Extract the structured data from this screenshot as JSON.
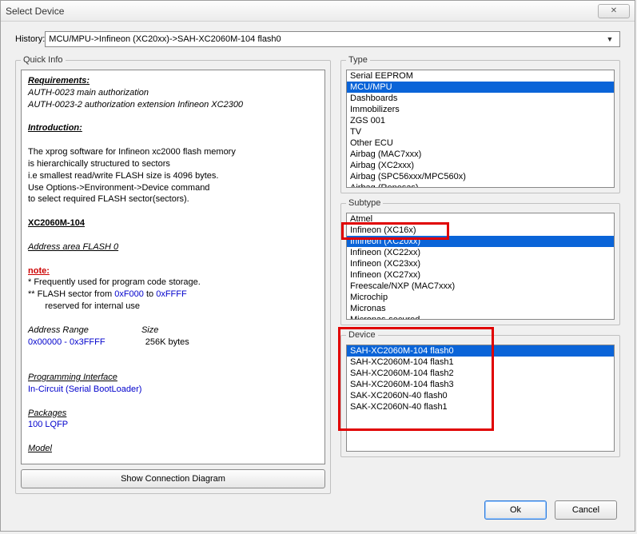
{
  "window": {
    "title": "Select Device"
  },
  "history": {
    "label": "History:",
    "value": "MCU/MPU->Infineon (XC20xx)->SAH-XC2060M-104 flash0"
  },
  "quickinfo": {
    "legend": "Quick Info",
    "requirements_hdr": "Requirements:",
    "req1": "AUTH-0023  main authorization",
    "req2": "AUTH-0023-2 authorization extension Infineon XC2300",
    "intro_hdr": "Introduction:",
    "intro1": "The xprog software for Infineon xc2000 flash memory",
    "intro2": "is hierarchically structured to sectors",
    "intro3": "i.e smallest read/write FLASH size is 4096 bytes.",
    "intro4": "Use Options->Environment->Device command",
    "intro5": "to select required FLASH  sector(sectors).",
    "part_hdr": "XC2060M-104",
    "addr_hdr": "Address area FLASH 0",
    "note_hdr": "note:",
    "note1": "* Frequently used for program code storage.",
    "note2a": "** FLASH sector from ",
    "note2b": "0xF000",
    "note2c": " to ",
    "note2d": "0xFFFF",
    "note3": "       reserved for internal use",
    "range_lbl": "Address Range",
    "size_lbl": "Size",
    "range_val": "0x00000 - 0x3FFFF",
    "size_val": "256K bytes",
    "prog_if_hdr": "Programming Interface",
    "prog_if_val": "In-Circuit (Serial BootLoader)",
    "pkg_hdr": "Packages",
    "pkg_val": "100 LQFP",
    "model_hdr": "Model",
    "conn_btn": "Show Connection Diagram"
  },
  "type": {
    "legend": "Type",
    "items": [
      "Serial EEPROM",
      "MCU/MPU",
      "Dashboards",
      "Immobilizers",
      "ZGS 001",
      "TV",
      "Other ECU",
      "Airbag (MAC7xxx)",
      "Airbag (XC2xxx)",
      "Airbag (SPC56xxx/MPC560x)",
      "Airbag (Renesas)"
    ],
    "selected": 1
  },
  "subtype": {
    "legend": "Subtype",
    "items": [
      "Atmel",
      "Infineon (XC16x)",
      "Infineon (XC20xx)",
      "Infineon (XC22xx)",
      "Infineon (XC23xx)",
      "Infineon (XC27xx)",
      "Freescale/NXP (MAC7xxx)",
      "Microchip",
      "Micronas",
      "Micronas-secured"
    ],
    "selected": 2
  },
  "device": {
    "legend": "Device",
    "items": [
      "SAH-XC2060M-104 flash0",
      "SAH-XC2060M-104 flash1",
      "SAH-XC2060M-104 flash2",
      "SAH-XC2060M-104 flash3",
      "SAK-XC2060N-40 flash0",
      "SAK-XC2060N-40 flash1"
    ],
    "selected": 0
  },
  "buttons": {
    "ok": "Ok",
    "cancel": "Cancel"
  }
}
